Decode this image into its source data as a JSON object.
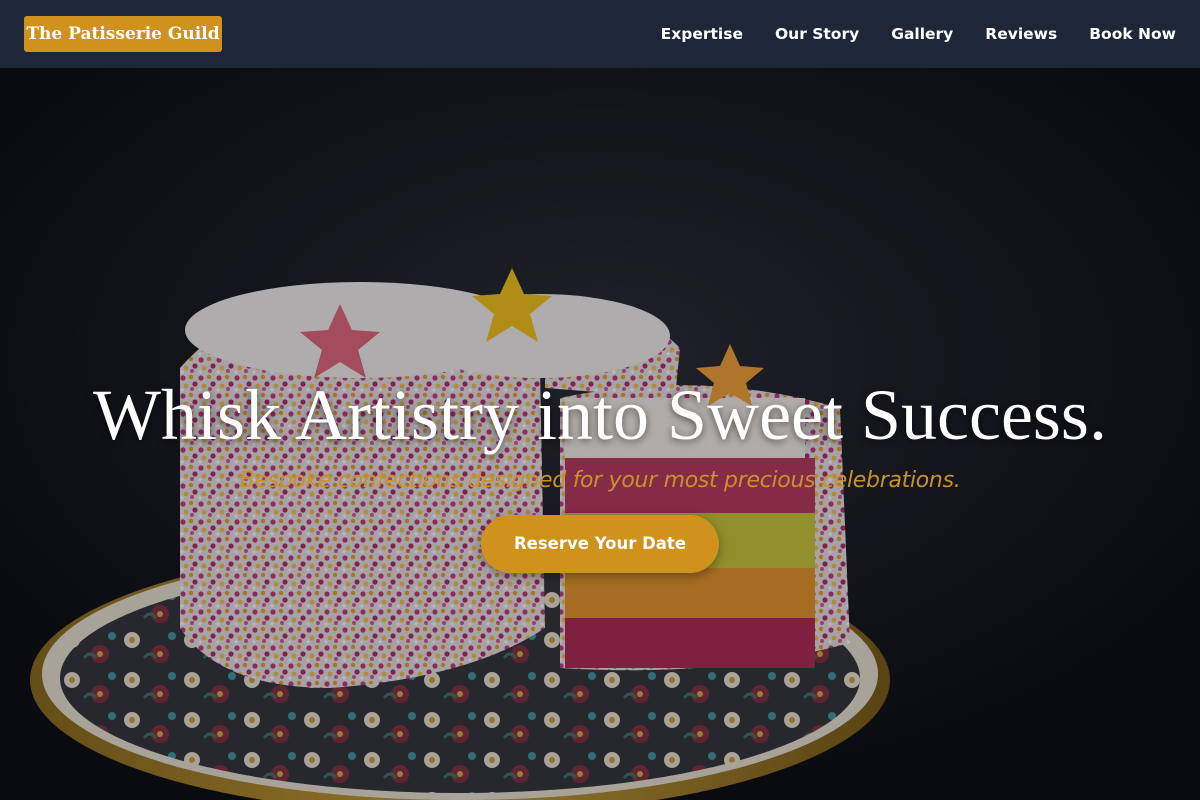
{
  "brand": {
    "name": "The Patisserie Guild",
    "accent_color": "#cf921d"
  },
  "nav": {
    "items": [
      {
        "label": "Expertise"
      },
      {
        "label": "Our Story"
      },
      {
        "label": "Gallery"
      },
      {
        "label": "Reviews"
      },
      {
        "label": "Book Now"
      }
    ]
  },
  "hero": {
    "headline": "Whisk Artistry into Sweet Success.",
    "subheadline": "Bespoke confections designed for your most precious celebrations.",
    "cta_label": "Reserve Your Date",
    "background_image": "layered-celebration-cake-with-sprinkles-and-star-toppers"
  },
  "colors": {
    "navbar_bg": "#1e2738",
    "subheadline": "#c7922a",
    "button": "#cf921d"
  }
}
